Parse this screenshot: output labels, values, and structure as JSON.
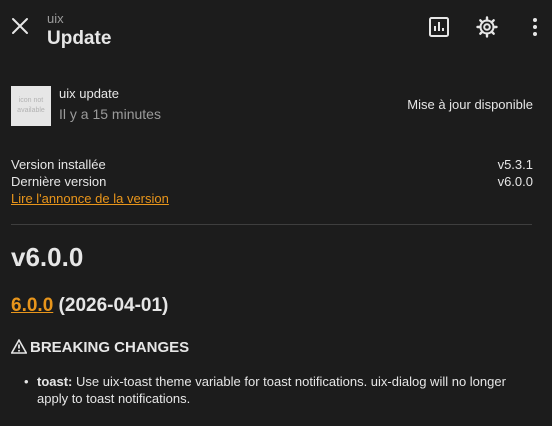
{
  "header": {
    "subtitle": "uix",
    "title": "Update",
    "icons": [
      "close-icon",
      "chart-icon",
      "gear-icon",
      "more-vertical-icon"
    ]
  },
  "entity": {
    "icon_placeholder": "icon not available",
    "name": "uix update",
    "time": "Il y a 15 minutes",
    "state": "Mise à jour disponible"
  },
  "versions": {
    "installed_label": "Version installée",
    "installed_value": "v5.3.1",
    "latest_label": "Dernière version",
    "latest_value": "v6.0.0",
    "release_link": "Lire l'annonce de la version"
  },
  "changelog": {
    "heading": "v6.0.0",
    "release_link": "6.0.0",
    "release_date": " (2026-04-01)",
    "section_title": "BREAKING CHANGES",
    "items": [
      {
        "bold": "toast:",
        "text": " Use uix-toast theme variable for toast notifications. uix-dialog will no longer apply to toast notifications."
      }
    ]
  },
  "colors": {
    "background": "#1c1c1c",
    "accent_link": "#e8951b",
    "text": "#e1e1e1",
    "secondary_text": "#9b9b9b"
  }
}
